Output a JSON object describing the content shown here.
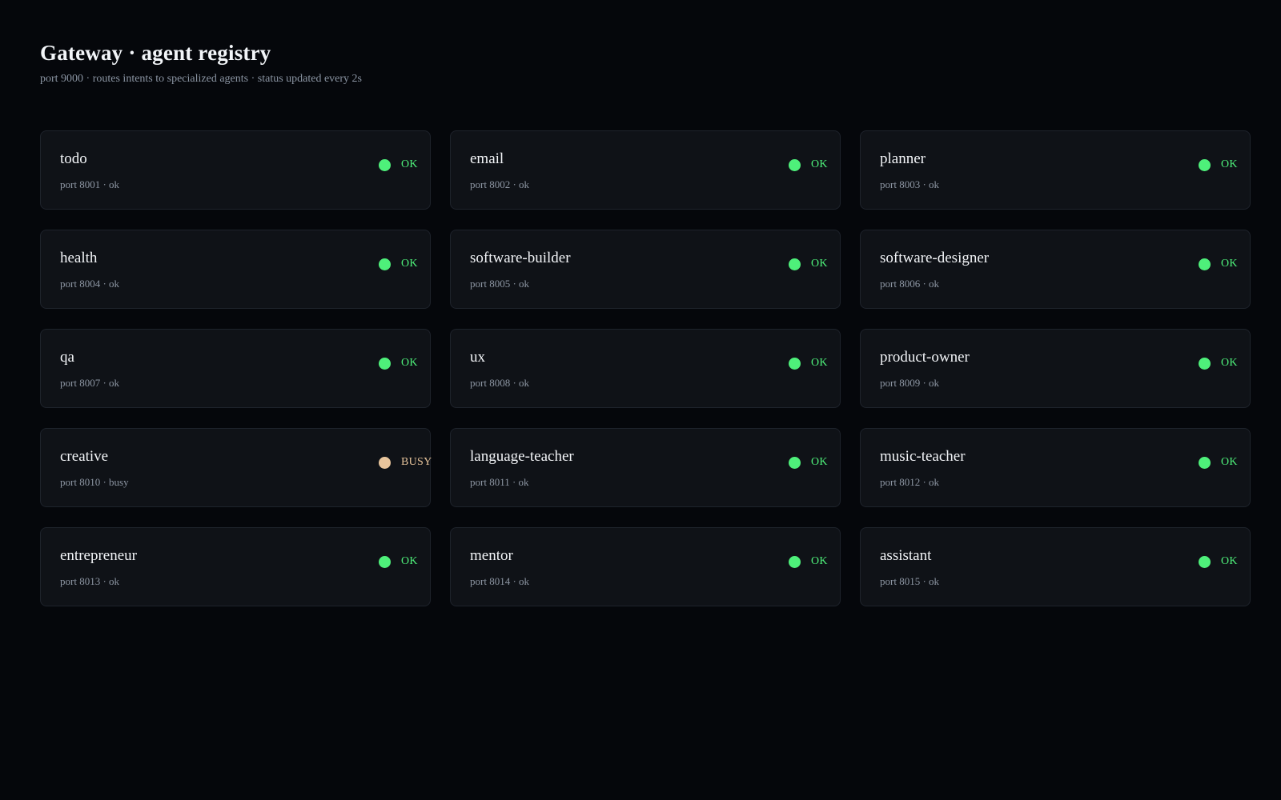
{
  "header": {
    "title": "Gateway · agent registry",
    "subtitle": "port 9000 · routes intents to specialized agents · status updated every 2s"
  },
  "colors": {
    "background": "#05070b",
    "card": "#0f1217",
    "ok": "#4ef07a",
    "busy": "#e8c59c"
  },
  "agents": [
    {
      "name": "todo",
      "meta": "port 8001 · ok",
      "status": "ok",
      "status_label": "OK"
    },
    {
      "name": "email",
      "meta": "port 8002 · ok",
      "status": "ok",
      "status_label": "OK"
    },
    {
      "name": "planner",
      "meta": "port 8003 · ok",
      "status": "ok",
      "status_label": "OK"
    },
    {
      "name": "health",
      "meta": "port 8004 · ok",
      "status": "ok",
      "status_label": "OK"
    },
    {
      "name": "software-builder",
      "meta": "port 8005 · ok",
      "status": "ok",
      "status_label": "OK"
    },
    {
      "name": "software-designer",
      "meta": "port 8006 · ok",
      "status": "ok",
      "status_label": "OK"
    },
    {
      "name": "qa",
      "meta": "port 8007 · ok",
      "status": "ok",
      "status_label": "OK"
    },
    {
      "name": "ux",
      "meta": "port 8008 · ok",
      "status": "ok",
      "status_label": "OK"
    },
    {
      "name": "product-owner",
      "meta": "port 8009 · ok",
      "status": "ok",
      "status_label": "OK"
    },
    {
      "name": "creative",
      "meta": "port 8010 · busy",
      "status": "busy",
      "status_label": "BUSY"
    },
    {
      "name": "language-teacher",
      "meta": "port 8011 · ok",
      "status": "ok",
      "status_label": "OK"
    },
    {
      "name": "music-teacher",
      "meta": "port 8012 · ok",
      "status": "ok",
      "status_label": "OK"
    },
    {
      "name": "entrepreneur",
      "meta": "port 8013 · ok",
      "status": "ok",
      "status_label": "OK"
    },
    {
      "name": "mentor",
      "meta": "port 8014 · ok",
      "status": "ok",
      "status_label": "OK"
    },
    {
      "name": "assistant",
      "meta": "port 8015 · ok",
      "status": "ok",
      "status_label": "OK"
    }
  ]
}
